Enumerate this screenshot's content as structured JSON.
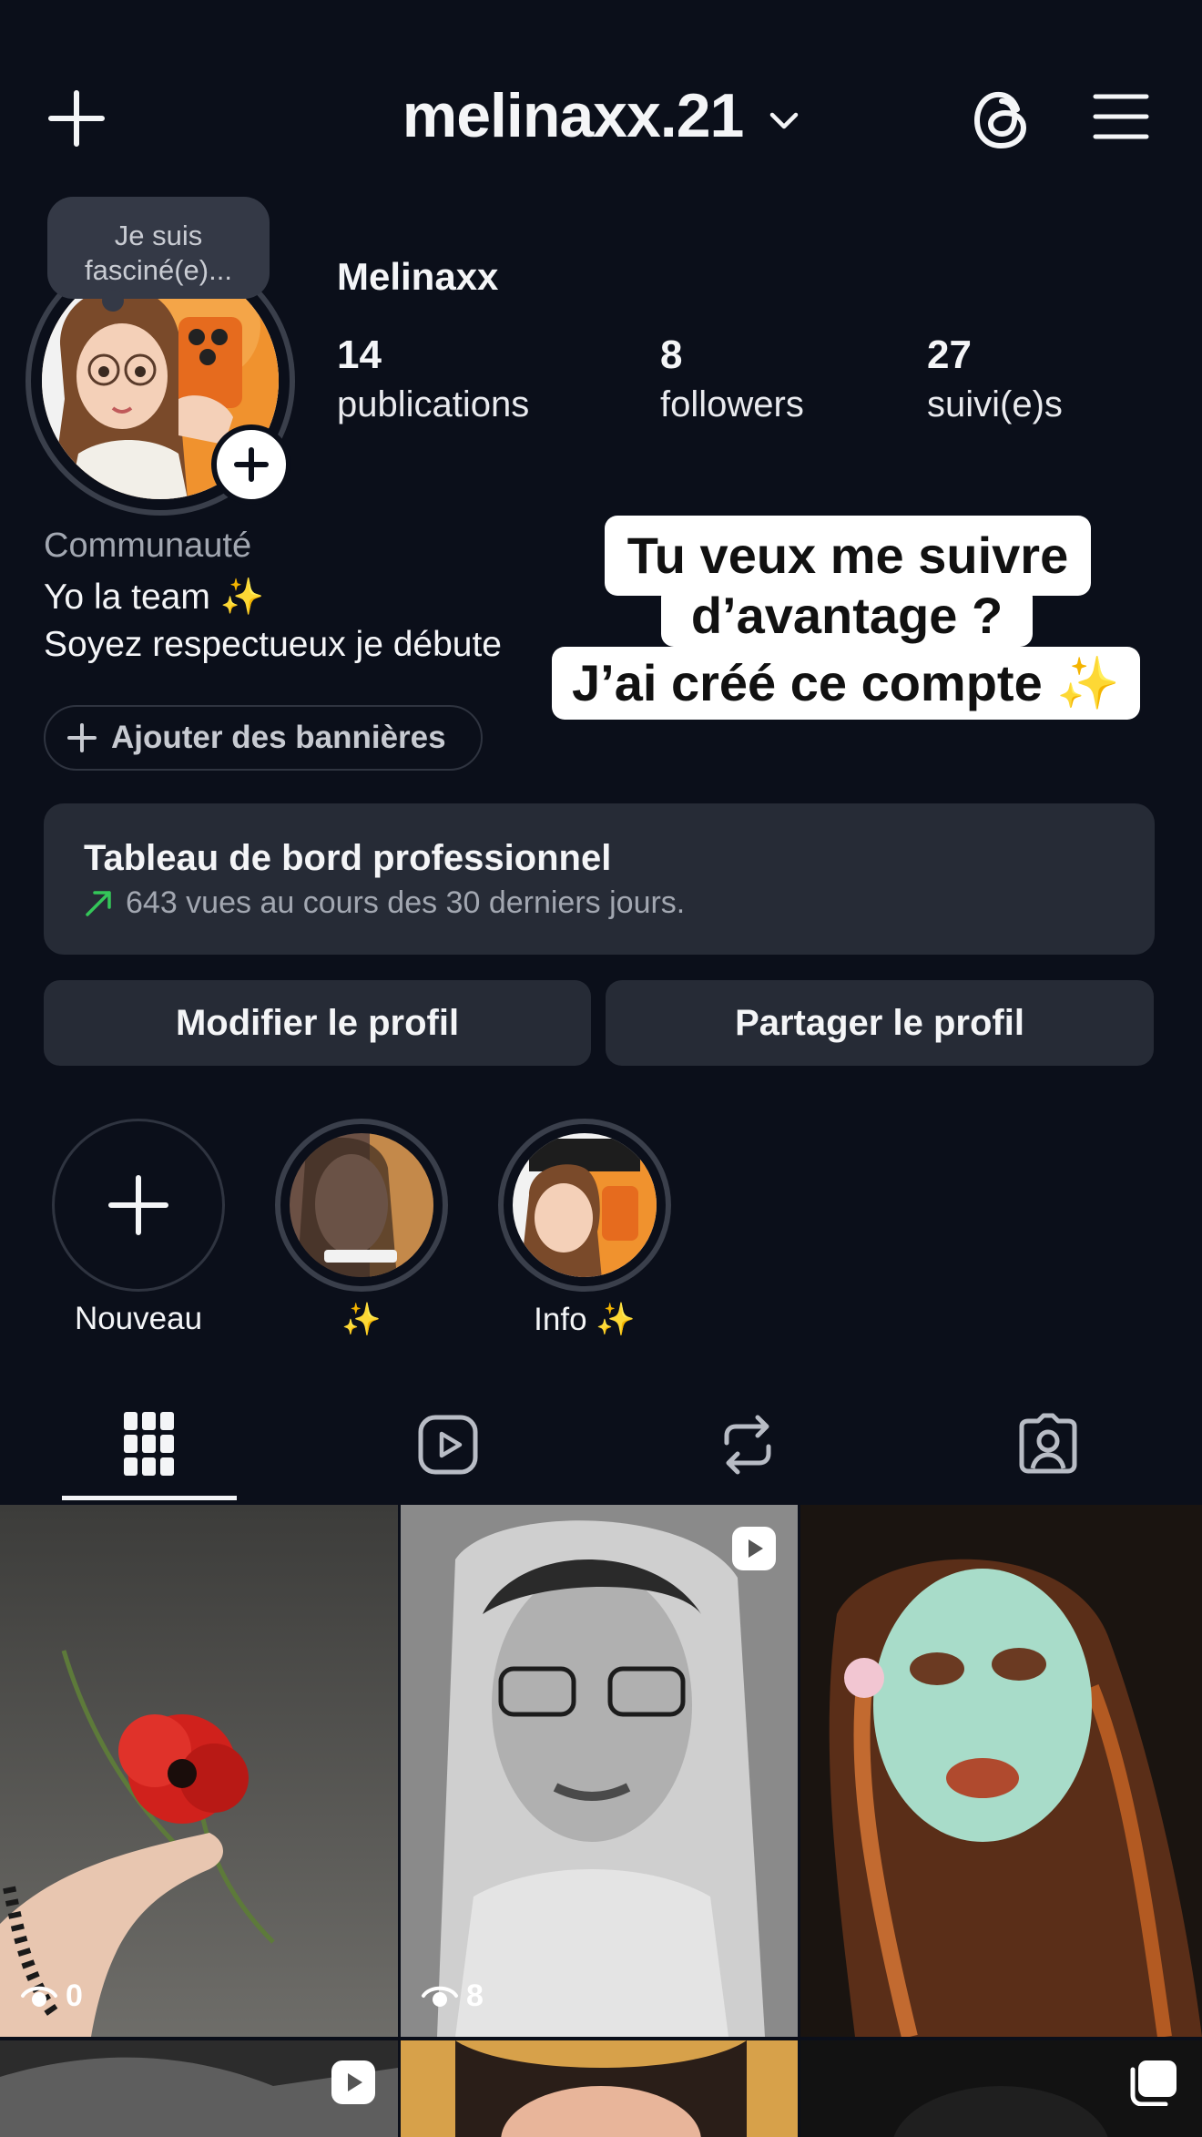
{
  "header": {
    "username": "melinaxx.21"
  },
  "profile": {
    "note": "Je suis fasciné(e)...",
    "display_name": "Melinaxx",
    "stats": [
      {
        "count": "14",
        "label": "publications"
      },
      {
        "count": "8",
        "label": "followers"
      },
      {
        "count": "27",
        "label": "suivi(e)s"
      }
    ],
    "category": "Communauté",
    "bio_line1": "Yo la team ✨",
    "bio_line2": "Soyez respectueux je débute",
    "add_banners_label": "Ajouter des bannières"
  },
  "caption_overlay": {
    "line1": "Tu veux me suivre",
    "line2": "d’avantage ?",
    "line3": "J’ai créé ce compte ✨"
  },
  "dashboard": {
    "title": "Tableau de bord professionnel",
    "subtitle": "643 vues au cours des 30 derniers jours.",
    "accent_color": "#34c759"
  },
  "actions": {
    "edit_profile": "Modifier le profil",
    "share_profile": "Partager le profil"
  },
  "highlights": [
    {
      "label": "Nouveau"
    },
    {
      "label": "✨"
    },
    {
      "label": "Info ✨"
    }
  ],
  "tabs": [
    "grid-icon",
    "reels-icon",
    "reposts-icon",
    "tagged-icon"
  ],
  "grid": [
    {
      "kind": "photo",
      "views": "0"
    },
    {
      "kind": "reel",
      "views": "8"
    },
    {
      "kind": "photo",
      "views": ""
    },
    {
      "kind": "reel",
      "views": ""
    },
    {
      "kind": "photo",
      "views": ""
    },
    {
      "kind": "carousel",
      "views": ""
    }
  ]
}
